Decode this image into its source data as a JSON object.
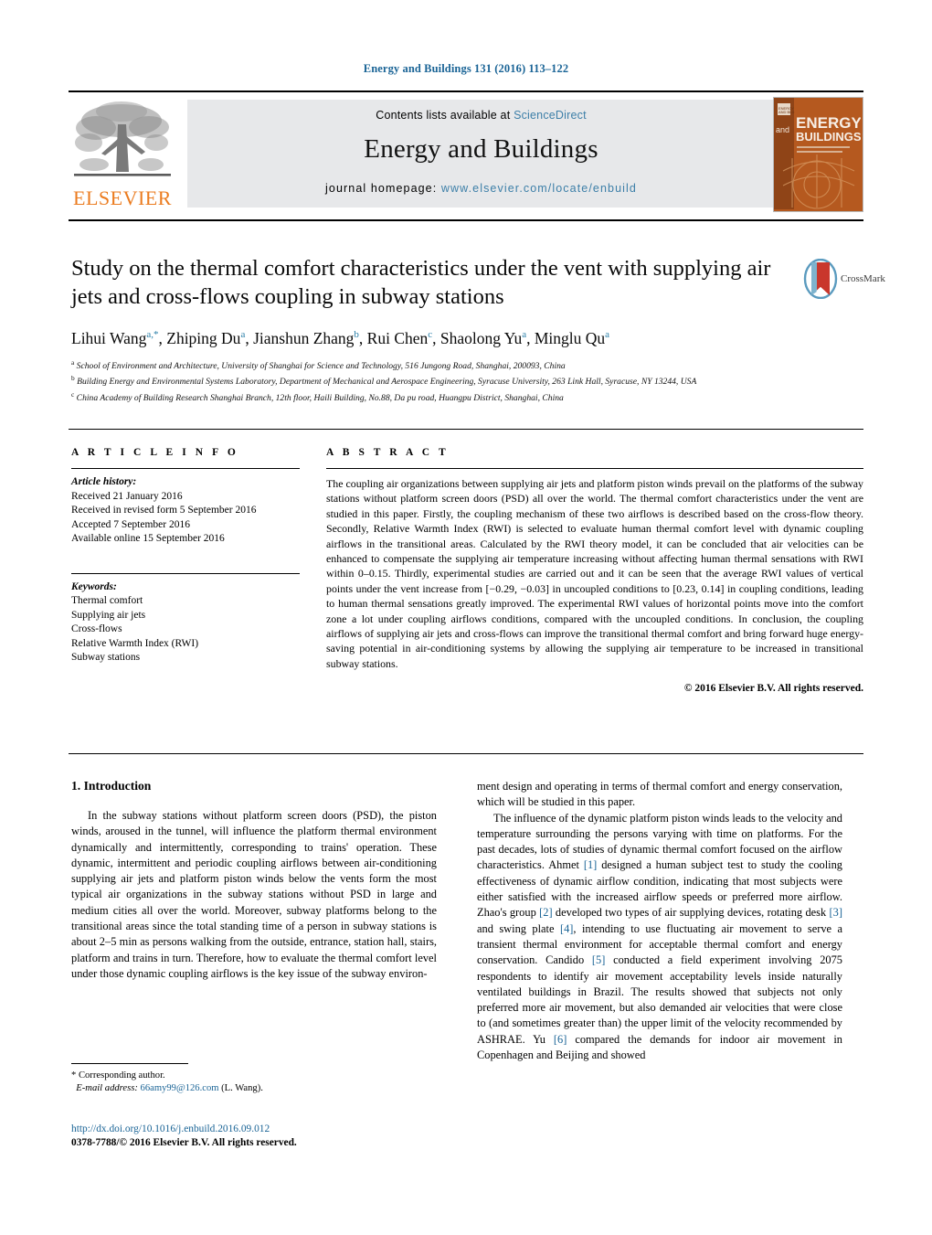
{
  "running_head": "Energy and Buildings 131 (2016) 113–122",
  "masthead": {
    "publisher_name": "ELSEVIER",
    "contents_prefix": "Contents lists available at",
    "contents_link": "ScienceDirect",
    "journal_name": "Energy and Buildings",
    "homepage_prefix": "journal homepage:",
    "homepage_url": "www.elsevier.com/locate/enbuild",
    "cover": {
      "line_and": "and",
      "line_energy": "ENERGY",
      "line_buildings": "BUILDINGS"
    }
  },
  "article": {
    "title": "Study on the thermal comfort characteristics under the vent with supplying air jets and cross-flows coupling in subway stations",
    "authors_html": "Lihui Wang<sup>a,*</sup>, Zhiping Du<sup>a</sup>, Jianshun Zhang<sup>b</sup>, Rui Chen<sup>c</sup>, Shaolong Yu<sup>a</sup>, Minglu Qu<sup>a</sup>",
    "crossmark_label": "CrossMark",
    "affiliations": [
      "<sup>a</sup> School of Environment and Architecture, University of Shanghai for Science and Technology, 516 Jungong Road, Shanghai, 200093, China",
      "<sup>b</sup> Building Energy and Environmental Systems Laboratory, Department of Mechanical and Aerospace Engineering, Syracuse University, 263 Link Hall, Syracuse, NY 13244, USA",
      "<sup>c</sup> China Academy of Building Research Shanghai Branch, 12th floor, Haili Building, No.88, Da pu road, Huangpu District, Shanghai, China"
    ]
  },
  "article_info": {
    "heading": "A R T I C L E   I N F O",
    "history_label": "Article history:",
    "history": [
      "Received 21 January 2016",
      "Received in revised form 5 September 2016",
      "Accepted 7 September 2016",
      "Available online 15 September 2016"
    ],
    "keywords_label": "Keywords:",
    "keywords": [
      "Thermal comfort",
      "Supplying air jets",
      "Cross-flows",
      "Relative Warmth Index (RWI)",
      "Subway stations"
    ]
  },
  "abstract": {
    "heading": "A B S T R A C T",
    "text": "The coupling air organizations between supplying air jets and platform piston winds prevail on the platforms of the subway stations without platform screen doors (PSD) all over the world. The thermal comfort characteristics under the vent are studied in this paper. Firstly, the coupling mechanism of these two airflows is described based on the cross-flow theory. Secondly, Relative Warmth Index (RWI) is selected to evaluate human thermal comfort level with dynamic coupling airflows in the transitional areas. Calculated by the RWI theory model, it can be concluded that air velocities can be enhanced to compensate the supplying air temperature increasing without affecting human thermal sensations with RWI within 0–0.15. Thirdly, experimental studies are carried out and it can be seen that the average RWI values of vertical points under the vent increase from [−0.29, −0.03] in uncoupled conditions to [0.23, 0.14] in coupling conditions, leading to human thermal sensations greatly improved. The experimental RWI values of horizontal points move into the comfort zone a lot under coupling airflows conditions, compared with the uncoupled conditions. In conclusion, the coupling airflows of supplying air jets and cross-flows can improve the transitional thermal comfort and bring forward huge energy-saving potential in air-conditioning systems by allowing the supplying air temperature to be increased in transitional subway stations.",
    "copyright": "© 2016 Elsevier B.V. All rights reserved."
  },
  "body": {
    "section_heading": "1.  Introduction",
    "left_paragraphs": [
      "In the subway stations without platform screen doors (PSD), the piston winds, aroused in the tunnel, will influence the platform thermal environment dynamically and intermittently, corresponding to trains' operation. These dynamic, intermittent and periodic coupling airflows between air-conditioning supplying air jets and platform piston winds below the vents form the most typical air organizations in the subway stations without PSD in large and medium cities all over the world. Moreover, subway platforms belong to the transitional areas since the total standing time of a person in subway stations is about 2–5 min as persons walking from the outside, entrance, station hall, stairs, platform and trains in turn. Therefore, how to evaluate the thermal comfort level under those dynamic coupling airflows is the key issue of the subway environ-"
    ],
    "right_paragraph_1": "ment design and operating in terms of thermal comfort and energy conservation, which will be studied in this paper.",
    "right_paragraph_2_html": "The influence of the dynamic platform piston winds leads to the velocity and temperature surrounding the persons varying with time on platforms. For the past decades, lots of studies of dynamic thermal comfort focused on the airflow characteristics. Ahmet <span class=\"ref\">[1]</span> designed a human subject test to study the cooling effectiveness of dynamic airflow condition, indicating that most subjects were either satisfied with the increased airflow speeds or preferred more airflow. Zhao's group <span class=\"ref\">[2]</span> developed two types of air supplying devices, rotating desk <span class=\"ref\">[3]</span> and swing plate <span class=\"ref\">[4]</span>, intending to use fluctuating air movement to serve a transient thermal environment for acceptable thermal comfort and energy conservation. Candido <span class=\"ref\">[5]</span> conducted a field experiment involving 2075 respondents to identify air movement acceptability levels inside naturally ventilated buildings in Brazil. The results showed that subjects not only preferred more air movement, but also demanded air velocities that were close to (and sometimes greater than) the upper limit of the velocity recommended by ASHRAE. Yu <span class=\"ref\">[6]</span> compared the demands for indoor air movement in Copenhagen and Beijing and showed"
  },
  "footnote": {
    "corresponding": "*  Corresponding author.",
    "email_label": "E-mail address:",
    "email": "66amy99@126.com",
    "email_suffix": "(L. Wang)."
  },
  "footer": {
    "doi": "http://dx.doi.org/10.1016/j.enbuild.2016.09.012",
    "issn_line": "0378-7788/© 2016 Elsevier B.V. All rights reserved."
  },
  "colors": {
    "link_blue": "#1a6496",
    "masthead_link": "#3d7fa8",
    "elsevier_orange": "#eb7c20",
    "band_grey": "#e7e8ea",
    "cover_orange": "#b5591f"
  }
}
